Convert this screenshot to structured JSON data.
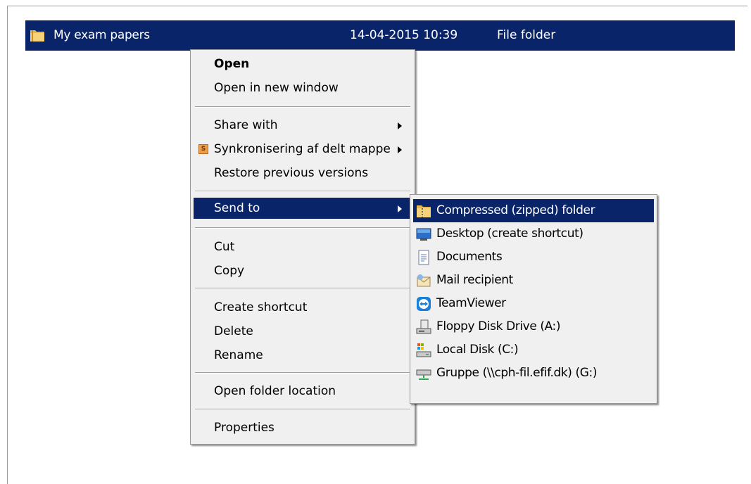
{
  "file_row": {
    "name": "My exam papers",
    "date_modified": "14-04-2015 10:39",
    "type": "File folder",
    "icon": "folder-icon"
  },
  "context_menu": {
    "open": "Open",
    "open_new_window": "Open in new window",
    "share_with": "Share with",
    "sync_shared": "Synkronisering af delt mappe",
    "sync_icon_letter": "S",
    "restore": "Restore previous versions",
    "send_to": "Send to",
    "cut": "Cut",
    "copy": "Copy",
    "create_shortcut": "Create shortcut",
    "delete": "Delete",
    "rename": "Rename",
    "open_folder_location": "Open folder location",
    "properties": "Properties"
  },
  "send_to_menu": {
    "items": [
      {
        "label": "Compressed (zipped) folder",
        "icon": "zip-folder-icon"
      },
      {
        "label": "Desktop (create shortcut)",
        "icon": "desktop-icon"
      },
      {
        "label": "Documents",
        "icon": "documents-icon"
      },
      {
        "label": "Mail recipient",
        "icon": "mail-icon"
      },
      {
        "label": "TeamViewer",
        "icon": "teamviewer-icon"
      },
      {
        "label": "Floppy Disk Drive (A:)",
        "icon": "floppy-drive-icon"
      },
      {
        "label": "Local Disk (C:)",
        "icon": "local-disk-icon"
      },
      {
        "label": "Gruppe (\\\\cph-fil.efif.dk) (G:)",
        "icon": "network-drive-icon"
      }
    ]
  },
  "colors": {
    "selection": "#0a246a",
    "menu_background": "#f0f0f0"
  }
}
